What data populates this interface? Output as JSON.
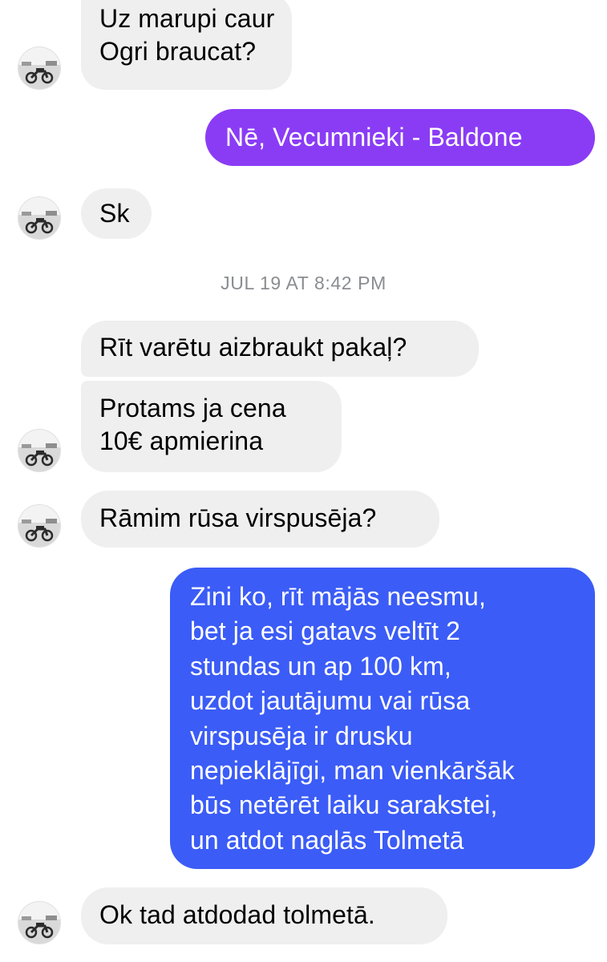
{
  "messages": [
    {
      "text": "Uz marupi caur\nOgri braucat?"
    },
    {
      "text": "Nē, Vecumnieki - Baldone"
    },
    {
      "text": "Sk"
    },
    {
      "text": "Rīt varētu aizbraukt pakaļ?"
    },
    {
      "text": "Protams ja cena\n10€ apmierina"
    },
    {
      "text": "Rāmim rūsa virspusēja?"
    },
    {
      "text": "Zini ko, rīt mājās neesmu,\nbet ja esi gatavs veltīt 2\nstundas un ap 100 km,\nuzdot jautājumu vai rūsa\nvirspusēja ir drusku\nnepieklājīgi, man vienkāršāk\nbūs netērēt laiku sarakstei,\nun atdot naglās Tolmetā"
    },
    {
      "text": "Ok tad atdodad tolmetā."
    }
  ],
  "timestamp": "JUL 19 AT 8:42 PM",
  "avatar": {
    "icon": "motorcycle-avatar-icon"
  },
  "colors": {
    "incoming_bubble": "#efefef",
    "outgoing_purple": "#8a3cf5",
    "outgoing_blue": "#3b5cf6",
    "timestamp_text": "#8a8d91"
  }
}
